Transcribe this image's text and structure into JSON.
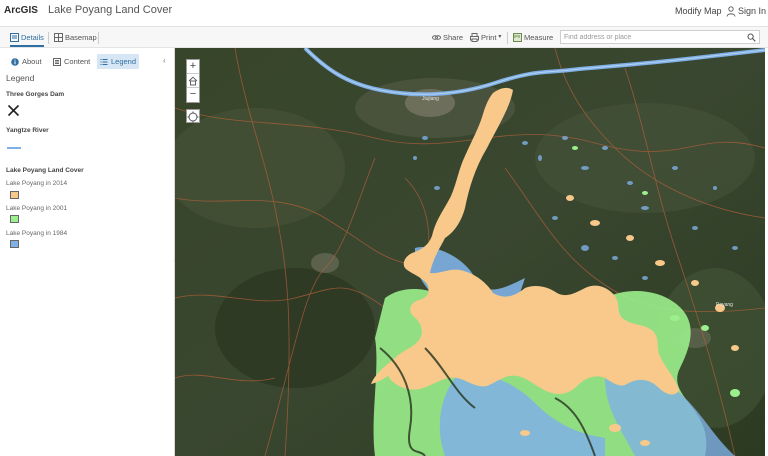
{
  "header": {
    "brand": "ArcGIS",
    "title": "Lake Poyang Land Cover",
    "modify_map": "Modify Map",
    "sign_in": "Sign In"
  },
  "toolbar": {
    "details": "Details",
    "basemap": "Basemap",
    "share": "Share",
    "print": "Print",
    "measure": "Measure",
    "search_placeholder": "Find address or place"
  },
  "sidebar": {
    "tabs": [
      {
        "label": "About",
        "icon": "info-icon"
      },
      {
        "label": "Content",
        "icon": "content-icon"
      },
      {
        "label": "Legend",
        "icon": "legend-icon",
        "active": true
      }
    ],
    "heading": "Legend",
    "legend": {
      "dam_layer": "Three Gorges Dam",
      "river_layer": "Yangtze River",
      "cover_layer": "Lake Poyang Land Cover",
      "items": [
        {
          "label": "Lake Poyang in 2014",
          "color": "#f8c98a"
        },
        {
          "label": "Lake Poyang in 2001",
          "color": "#9bef8c"
        },
        {
          "label": "Lake Poyang in 1984",
          "color": "#7fb0e6"
        }
      ]
    }
  },
  "map": {
    "zoom_in": "+",
    "zoom_out": "−",
    "labels": {
      "city_north": "Jiujiang",
      "city_east": "Poyang"
    },
    "colors": {
      "lake_2014": "#f8c98a",
      "lake_2001": "#9bef8c",
      "lake_1984": "#7fb0e6",
      "terrain": "#2f3a24"
    }
  }
}
